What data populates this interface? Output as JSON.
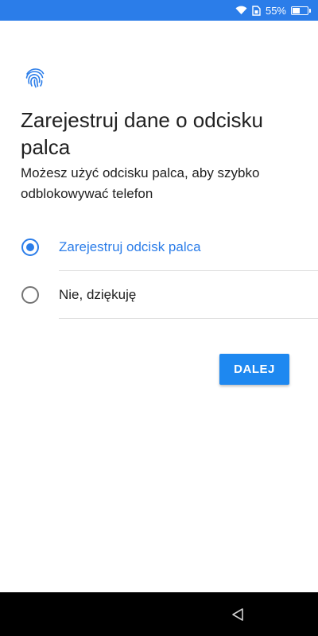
{
  "status_bar": {
    "battery_text": "55%",
    "battery_level": 0.55,
    "icons": [
      "wifi-icon",
      "sim-icon",
      "battery-icon"
    ]
  },
  "header": {
    "icon": "fingerprint-icon",
    "title": "Zarejestruj dane o odcisku palca",
    "subtitle": "Możesz użyć odcisku palca, aby szybko odblokowywać telefon"
  },
  "options": [
    {
      "label": "Zarejestruj odcisk palca",
      "selected": true
    },
    {
      "label": "Nie, dziękuję",
      "selected": false
    }
  ],
  "actions": {
    "next_label": "DALEJ"
  },
  "nav_bar": {
    "icons": [
      "back-icon"
    ]
  },
  "colors": {
    "accent": "#2b7de9",
    "button": "#1e88f0",
    "text": "#212121"
  }
}
